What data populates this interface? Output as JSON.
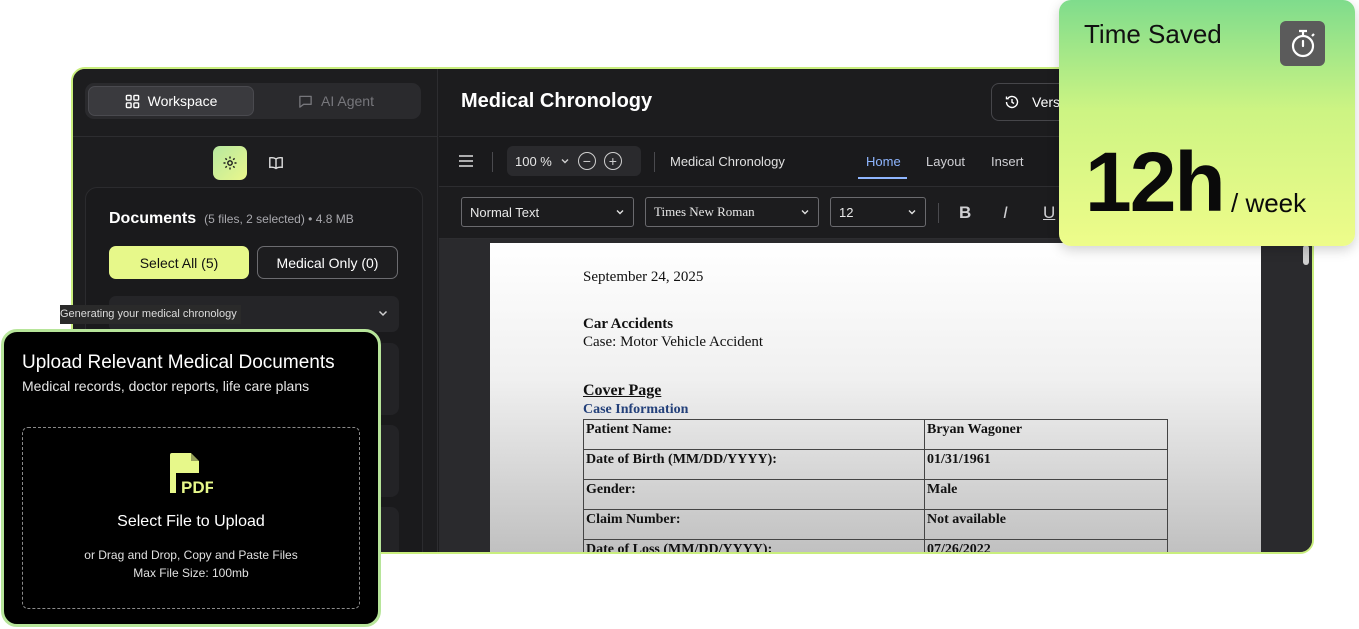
{
  "sidebar": {
    "tabs": [
      {
        "label": "Workspace",
        "icon": "grid-icon",
        "active": true
      },
      {
        "label": "AI Agent",
        "icon": "chat-icon",
        "active": false
      }
    ],
    "tools": [
      {
        "icon": "gear-icon",
        "active": true
      },
      {
        "icon": "book-icon",
        "active": false
      }
    ],
    "documents": {
      "title": "Documents",
      "meta": "(5 files, 2 selected) • 4.8 MB",
      "select_all_label": "Select All (5)",
      "medical_only_label": "Medical Only (0)"
    },
    "progress_tooltip": "Generating your medical chronology"
  },
  "header": {
    "title": "Medical Chronology",
    "version_label": "Vers"
  },
  "toolbar": {
    "zoom": "100 %",
    "doc_name": "Medical Chronology",
    "tabs": [
      {
        "label": "Home",
        "active": true
      },
      {
        "label": "Layout",
        "active": false
      },
      {
        "label": "Insert",
        "active": false
      }
    ],
    "style_select": "Normal Text",
    "font_select": "Times New Roman",
    "size_select": "12",
    "format_buttons": [
      "B",
      "I",
      "U"
    ]
  },
  "document": {
    "date": "September 24, 2025",
    "heading": "Car Accidents",
    "case_line": "Case: Motor Vehicle Accident",
    "cover_title": "Cover Page",
    "section_title": "Case Information",
    "rows": [
      {
        "label": "Patient Name:",
        "value": "Bryan Wagoner"
      },
      {
        "label": "Date of Birth (MM/DD/YYYY):",
        "value": "01/31/1961"
      },
      {
        "label": "Gender:",
        "value": "Male"
      },
      {
        "label": "Claim Number:",
        "value": "Not available"
      },
      {
        "label": "Date of Loss (MM/DD/YYYY):",
        "value": "07/26/2022"
      }
    ]
  },
  "upload": {
    "title": "Upload Relevant Medical Documents",
    "subtitle": "Medical records, doctor reports, life care plans",
    "icon": "pdf-file-icon",
    "icon_text": "PDF",
    "drop_title": "Select File to Upload",
    "drop_line1": "or Drag and Drop, Copy and Paste Files",
    "drop_line2": "Max File Size: 100mb"
  },
  "time_saved": {
    "label": "Time Saved",
    "value": "12h",
    "unit": "/ week",
    "icon": "stopwatch-icon"
  },
  "colors": {
    "accent_lime": "#e7f88a",
    "accent_green": "#b7e59a",
    "link_blue": "#8fb6ff",
    "doc_section_blue": "#23407a"
  }
}
